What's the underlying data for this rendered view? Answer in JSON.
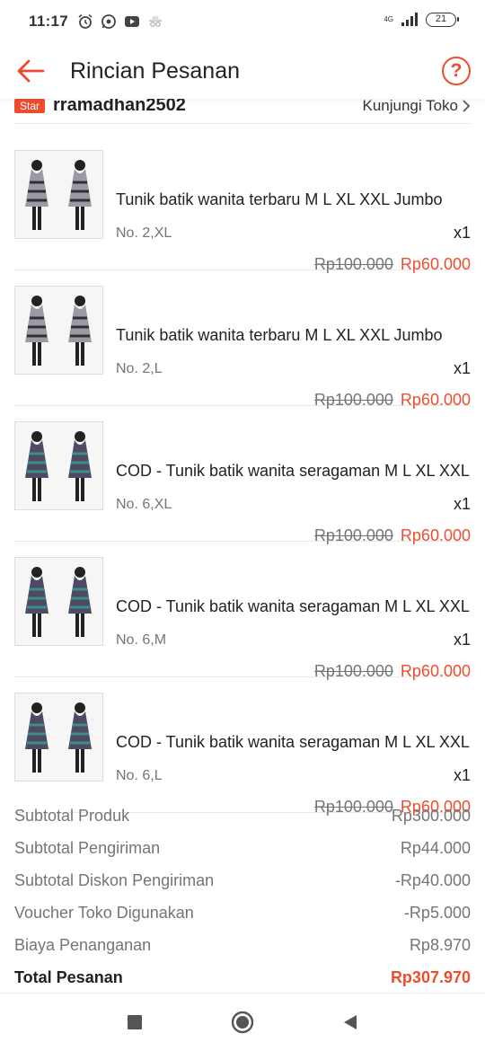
{
  "status_bar": {
    "time": "11:17",
    "network": "4G",
    "battery": "21",
    "icons": [
      "alarm-icon",
      "whatsapp-icon",
      "youtube-icon",
      "incognito-icon",
      "signal-icon",
      "battery-icon"
    ]
  },
  "header": {
    "title": "Rincian Pesanan",
    "help_label": "?"
  },
  "shop": {
    "badge": "Star",
    "name": "rramadhan2502",
    "visit_label": "Kunjungi Toko"
  },
  "items": [
    {
      "title": "Tunik batik wanita terbaru M L XL XXL Jumbo",
      "variant": "No. 2,XL",
      "qty": "x1",
      "price_old": "Rp100.000",
      "price_new": "Rp60.000"
    },
    {
      "title": "Tunik batik wanita terbaru M L XL XXL Jumbo",
      "variant": "No. 2,L",
      "qty": "x1",
      "price_old": "Rp100.000",
      "price_new": "Rp60.000"
    },
    {
      "title": "COD - Tunik batik wanita seragaman M L XL XXL",
      "variant": "No. 6,XL",
      "qty": "x1",
      "price_old": "Rp100.000",
      "price_new": "Rp60.000"
    },
    {
      "title": "COD - Tunik batik wanita seragaman M L XL XXL",
      "variant": "No. 6,M",
      "qty": "x1",
      "price_old": "Rp100.000",
      "price_new": "Rp60.000"
    },
    {
      "title": "COD - Tunik batik wanita seragaman M L XL XXL",
      "variant": "No. 6,L",
      "qty": "x1",
      "price_old": "Rp100.000",
      "price_new": "Rp60.000"
    }
  ],
  "summary": [
    {
      "label": "Subtotal Produk",
      "value": "Rp300.000"
    },
    {
      "label": "Subtotal Pengiriman",
      "value": "Rp44.000"
    },
    {
      "label": "Subtotal Diskon Pengiriman",
      "value": "-Rp40.000"
    },
    {
      "label": "Voucher Toko Digunakan",
      "value": "-Rp5.000"
    },
    {
      "label": "Biaya Penanganan",
      "value": "Rp8.970"
    }
  ],
  "total": {
    "label": "Total Pesanan",
    "value": "Rp307.970"
  },
  "colors": {
    "accent": "#ee4d2d",
    "muted": "#757575"
  }
}
